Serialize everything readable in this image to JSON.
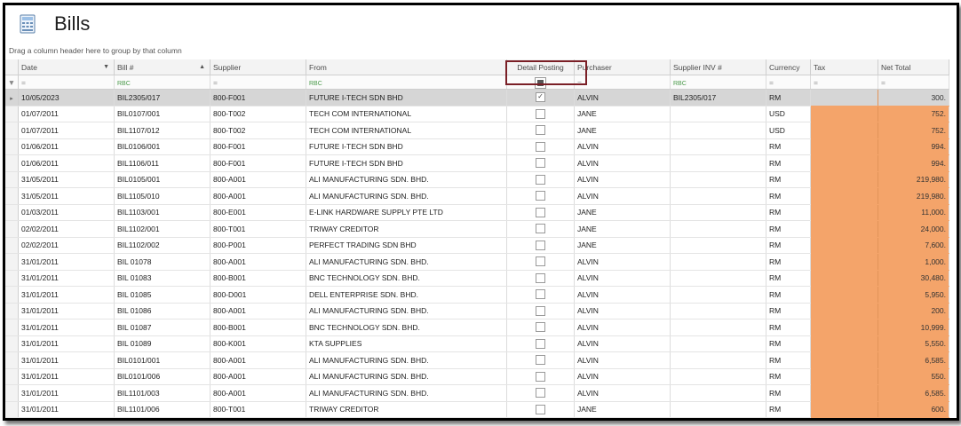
{
  "window": {
    "title": "Bills",
    "group_hint": "Drag a column header here to group by that column"
  },
  "columns": [
    {
      "key": "date",
      "label": "Date",
      "sort": "desc",
      "filter": "="
    },
    {
      "key": "bill",
      "label": "Bill #",
      "sort": "asc",
      "filter": "RBC"
    },
    {
      "key": "supplier",
      "label": "Supplier",
      "filter": "="
    },
    {
      "key": "from",
      "label": "From",
      "filter": "RBC"
    },
    {
      "key": "detail",
      "label": "Detail Posting",
      "filter": "checkbox"
    },
    {
      "key": "purchaser",
      "label": "Purchaser",
      "filter": "="
    },
    {
      "key": "supplier_inv",
      "label": "Supplier INV #",
      "filter": "RBC"
    },
    {
      "key": "currency",
      "label": "Currency",
      "filter": "="
    },
    {
      "key": "tax",
      "label": "Tax",
      "filter": "="
    },
    {
      "key": "net",
      "label": "Net Total",
      "filter": "="
    }
  ],
  "icons": {
    "filter_row": "filter-icon",
    "sort_desc": "sort-desc-icon",
    "sort_asc": "sort-asc-icon",
    "app": "calculator-icon"
  },
  "colors": {
    "highlight": "#7a1f26",
    "tax_fill": "#f4a46a",
    "selected_row": "#d6d6d6"
  },
  "rows": [
    {
      "date": "10/05/2023",
      "bill": "BIL2305/017",
      "supplier": "800-F001",
      "from": "FUTURE I-TECH SDN BHD",
      "detail": true,
      "purchaser": "ALVIN",
      "supplier_inv": "BIL2305/017",
      "currency": "RM",
      "net": "300.",
      "selected": true
    },
    {
      "date": "01/07/2011",
      "bill": "BIL0107/001",
      "supplier": "800-T002",
      "from": "TECH COM INTERNATIONAL",
      "detail": false,
      "purchaser": "JANE",
      "supplier_inv": "",
      "currency": "USD",
      "net": "752."
    },
    {
      "date": "01/07/2011",
      "bill": "BIL1107/012",
      "supplier": "800-T002",
      "from": "TECH COM INTERNATIONAL",
      "detail": false,
      "purchaser": "JANE",
      "supplier_inv": "",
      "currency": "USD",
      "net": "752."
    },
    {
      "date": "01/06/2011",
      "bill": "BIL0106/001",
      "supplier": "800-F001",
      "from": "FUTURE I-TECH SDN BHD",
      "detail": false,
      "purchaser": "ALVIN",
      "supplier_inv": "",
      "currency": "RM",
      "net": "994."
    },
    {
      "date": "01/06/2011",
      "bill": "BIL1106/011",
      "supplier": "800-F001",
      "from": "FUTURE I-TECH SDN BHD",
      "detail": false,
      "purchaser": "ALVIN",
      "supplier_inv": "",
      "currency": "RM",
      "net": "994."
    },
    {
      "date": "31/05/2011",
      "bill": "BIL0105/001",
      "supplier": "800-A001",
      "from": "ALI MANUFACTURING SDN. BHD.",
      "detail": false,
      "purchaser": "ALVIN",
      "supplier_inv": "",
      "currency": "RM",
      "net": "219,980."
    },
    {
      "date": "31/05/2011",
      "bill": "BIL1105/010",
      "supplier": "800-A001",
      "from": "ALI MANUFACTURING SDN. BHD.",
      "detail": false,
      "purchaser": "ALVIN",
      "supplier_inv": "",
      "currency": "RM",
      "net": "219,980."
    },
    {
      "date": "01/03/2011",
      "bill": "BIL1103/001",
      "supplier": "800-E001",
      "from": "E-LINK HARDWARE SUPPLY PTE LTD",
      "detail": false,
      "purchaser": "JANE",
      "supplier_inv": "",
      "currency": "RM",
      "net": "11,000."
    },
    {
      "date": "02/02/2011",
      "bill": "BIL1102/001",
      "supplier": "800-T001",
      "from": "TRIWAY CREDITOR",
      "detail": false,
      "purchaser": "JANE",
      "supplier_inv": "",
      "currency": "RM",
      "net": "24,000."
    },
    {
      "date": "02/02/2011",
      "bill": "BIL1102/002",
      "supplier": "800-P001",
      "from": "PERFECT TRADING SDN BHD",
      "detail": false,
      "purchaser": "JANE",
      "supplier_inv": "",
      "currency": "RM",
      "net": "7,600."
    },
    {
      "date": "31/01/2011",
      "bill": "BIL 01078",
      "supplier": "800-A001",
      "from": "ALI MANUFACTURING SDN. BHD.",
      "detail": false,
      "purchaser": "ALVIN",
      "supplier_inv": "",
      "currency": "RM",
      "net": "1,000."
    },
    {
      "date": "31/01/2011",
      "bill": "BIL 01083",
      "supplier": "800-B001",
      "from": "BNC TECHNOLOGY SDN. BHD.",
      "detail": false,
      "purchaser": "ALVIN",
      "supplier_inv": "",
      "currency": "RM",
      "net": "30,480."
    },
    {
      "date": "31/01/2011",
      "bill": "BIL 01085",
      "supplier": "800-D001",
      "from": "DELL ENTERPRISE SDN. BHD.",
      "detail": false,
      "purchaser": "ALVIN",
      "supplier_inv": "",
      "currency": "RM",
      "net": "5,950."
    },
    {
      "date": "31/01/2011",
      "bill": "BIL 01086",
      "supplier": "800-A001",
      "from": "ALI MANUFACTURING SDN. BHD.",
      "detail": false,
      "purchaser": "ALVIN",
      "supplier_inv": "",
      "currency": "RM",
      "net": "200."
    },
    {
      "date": "31/01/2011",
      "bill": "BIL 01087",
      "supplier": "800-B001",
      "from": "BNC TECHNOLOGY SDN. BHD.",
      "detail": false,
      "purchaser": "ALVIN",
      "supplier_inv": "",
      "currency": "RM",
      "net": "10,999."
    },
    {
      "date": "31/01/2011",
      "bill": "BIL 01089",
      "supplier": "800-K001",
      "from": "KTA SUPPLIES",
      "detail": false,
      "purchaser": "ALVIN",
      "supplier_inv": "",
      "currency": "RM",
      "net": "5,550."
    },
    {
      "date": "31/01/2011",
      "bill": "BIL0101/001",
      "supplier": "800-A001",
      "from": "ALI MANUFACTURING SDN. BHD.",
      "detail": false,
      "purchaser": "ALVIN",
      "supplier_inv": "",
      "currency": "RM",
      "net": "6,585."
    },
    {
      "date": "31/01/2011",
      "bill": "BIL0101/006",
      "supplier": "800-A001",
      "from": "ALI MANUFACTURING SDN. BHD.",
      "detail": false,
      "purchaser": "ALVIN",
      "supplier_inv": "",
      "currency": "RM",
      "net": "550."
    },
    {
      "date": "31/01/2011",
      "bill": "BIL1101/003",
      "supplier": "800-A001",
      "from": "ALI MANUFACTURING SDN. BHD.",
      "detail": false,
      "purchaser": "ALVIN",
      "supplier_inv": "",
      "currency": "RM",
      "net": "6,585."
    },
    {
      "date": "31/01/2011",
      "bill": "BIL1101/006",
      "supplier": "800-T001",
      "from": "TRIWAY CREDITOR",
      "detail": false,
      "purchaser": "JANE",
      "supplier_inv": "",
      "currency": "RM",
      "net": "600."
    }
  ]
}
